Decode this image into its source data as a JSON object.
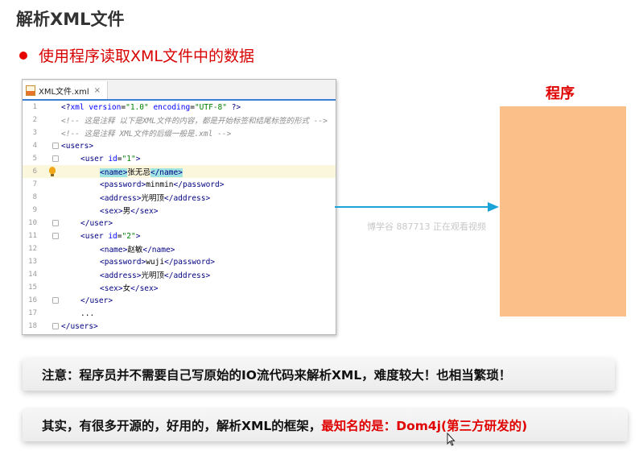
{
  "slide": {
    "title": "解析XML文件",
    "bullet": "使用程序读取XML文件中的数据",
    "program_label": "程序",
    "watermark": "博学谷 887713 正在观看视频",
    "note": "注意：程序员并不需要自己写原始的IO流代码来解析XML，难度较大！也相当繁琐！",
    "tip_part1": "其实，有很多开源的，好用的，解析XML的框架，",
    "tip_part2": "最知名的是：Dom4j(第三方研发的)"
  },
  "editor": {
    "tab_label": "XML文件.xml",
    "tab_close": "×",
    "lines": [
      {
        "n": "1"
      },
      {
        "n": "2"
      },
      {
        "n": "3"
      },
      {
        "n": "4"
      },
      {
        "n": "5"
      },
      {
        "n": "6"
      },
      {
        "n": "7"
      },
      {
        "n": "8"
      },
      {
        "n": "9"
      },
      {
        "n": "10"
      },
      {
        "n": "11"
      },
      {
        "n": "12"
      },
      {
        "n": "13"
      },
      {
        "n": "14"
      },
      {
        "n": "15"
      },
      {
        "n": "16"
      },
      {
        "n": "17"
      },
      {
        "n": "18"
      }
    ],
    "code": {
      "l1_a": "<?",
      "l1_b": "xml version",
      "l1_c": "=",
      "l1_d": "\"1.0\"",
      "l1_e": " encoding",
      "l1_f": "=",
      "l1_g": "\"UTF-8\"",
      "l1_h": " ?>",
      "l2": "<!-- 这是注释 以下是XML文件的内容，都是开始标签和结尾标签的形式 -->",
      "l3": "<!-- 这是注释 XML文件的后缀一般是.xml -->",
      "l4": "<users>",
      "l5_a": "<user",
      "l5_b": " id",
      "l5_c": "=",
      "l5_d": "\"1\"",
      "l5_e": ">",
      "l6_a": "<name>",
      "l6_b": "张无忌",
      "l6_c": "</name>",
      "l7_a": "<password>",
      "l7_b": "minmin",
      "l7_c": "</password>",
      "l8_a": "<address>",
      "l8_b": "光明顶",
      "l8_c": "</address>",
      "l9_a": "<sex>",
      "l9_b": "男",
      "l9_c": "</sex>",
      "l10": "</user>",
      "l11_a": "<user",
      "l11_b": " id",
      "l11_c": "=",
      "l11_d": "\"2\"",
      "l11_e": ">",
      "l12_a": "<name>",
      "l12_b": "赵敏",
      "l12_c": "</name>",
      "l13_a": "<password>",
      "l13_b": "wuji",
      "l13_c": "</password>",
      "l14_a": "<address>",
      "l14_b": "光明顶",
      "l14_c": "</address>",
      "l15_a": "<sex>",
      "l15_b": "女",
      "l15_c": "</sex>",
      "l16": "</user>",
      "l17": "...",
      "l18": "</users>"
    }
  },
  "colors": {
    "accent_red": "#e00000",
    "arrow": "#1aa3d6",
    "program_box": "#fbbf8a"
  },
  "icons": [
    "bullet-dot-icon",
    "xml-file-icon",
    "close-icon",
    "lightbulb-icon",
    "fold-marker-icon",
    "arrow-right-icon",
    "mouse-cursor-icon"
  ]
}
